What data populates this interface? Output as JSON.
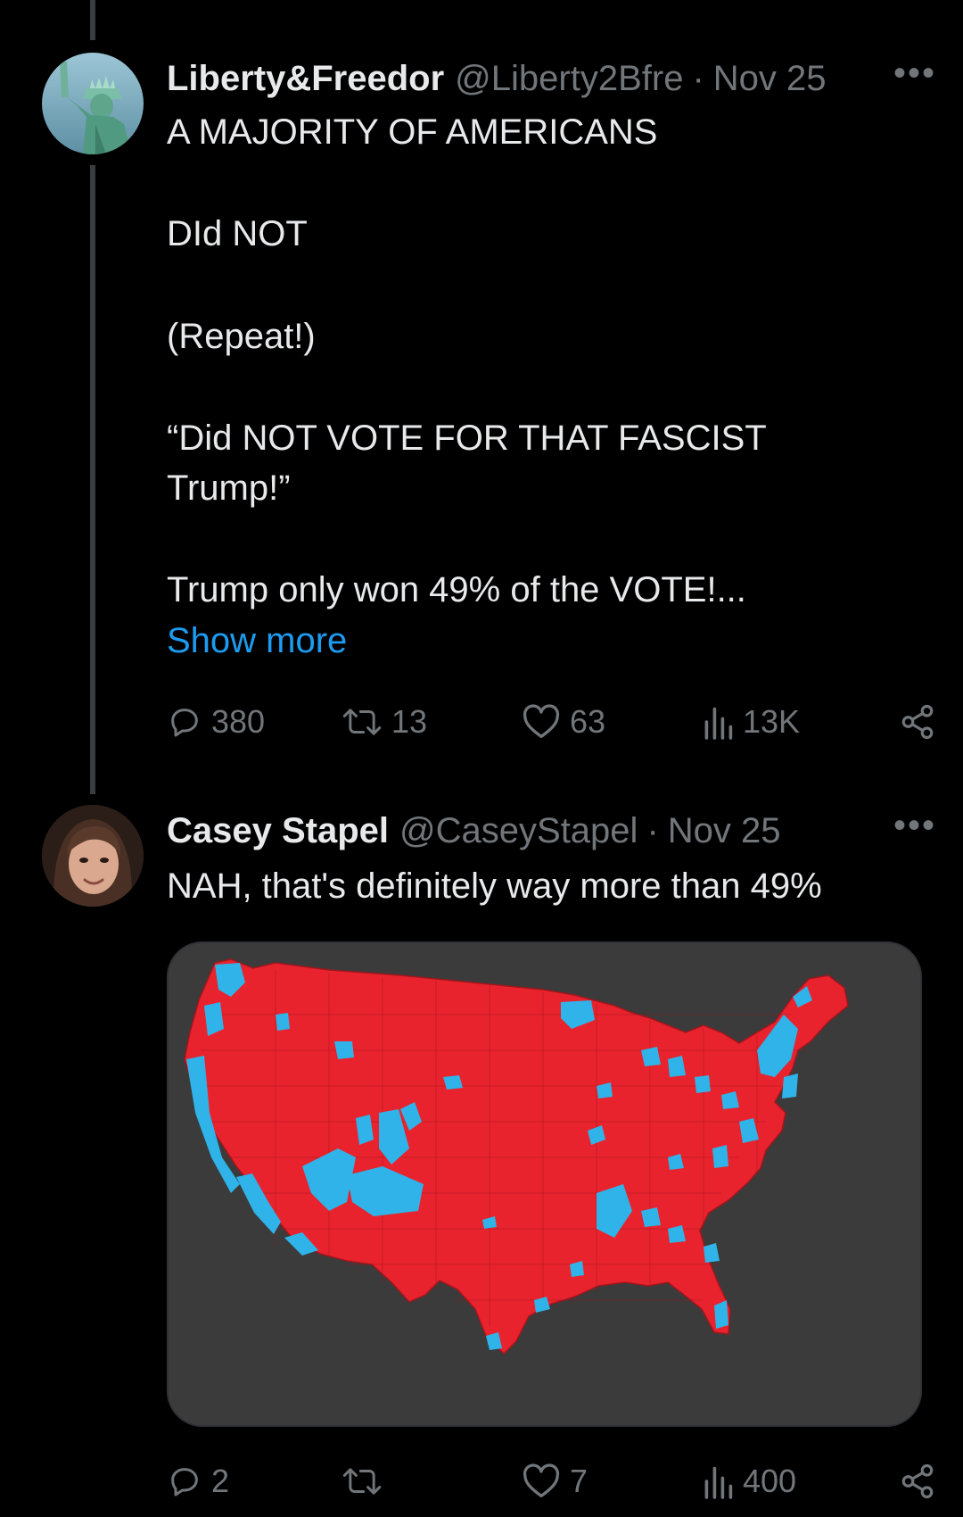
{
  "tweets": [
    {
      "display_name": "Liberty&Freedor",
      "handle": "@Liberty2Bfre",
      "separator": "·",
      "date": "Nov 25",
      "more_label": "•••",
      "text_lines": [
        "A MAJORITY OF AMERICANS",
        "DId NOT",
        "(Repeat!)",
        "“Did NOT VOTE FOR THAT FASCIST",
        "Trump!”",
        "Trump only won 49% of the VOTE!..."
      ],
      "show_more": "Show more",
      "stats": {
        "replies": "380",
        "reposts": "13",
        "likes": "63",
        "views": "13K"
      }
    },
    {
      "display_name": "Casey Stapel",
      "handle": "@CaseyStapel",
      "separator": "·",
      "date": "Nov 25",
      "more_label": "•••",
      "text": "NAH, that's definitely way more than 49%",
      "stats": {
        "replies": "2",
        "reposts": "",
        "likes": "7",
        "views": "400"
      }
    }
  ],
  "colors": {
    "background": "#000000",
    "text": "#e7e9ea",
    "muted": "#71767b",
    "link": "#1d9bf0",
    "map_red": "#e8232e",
    "map_blue": "#2fb3e8",
    "map_bg": "#3b3b3b"
  },
  "icons": [
    "reply-icon",
    "repost-icon",
    "like-icon",
    "views-icon",
    "share-icon",
    "more-icon"
  ]
}
